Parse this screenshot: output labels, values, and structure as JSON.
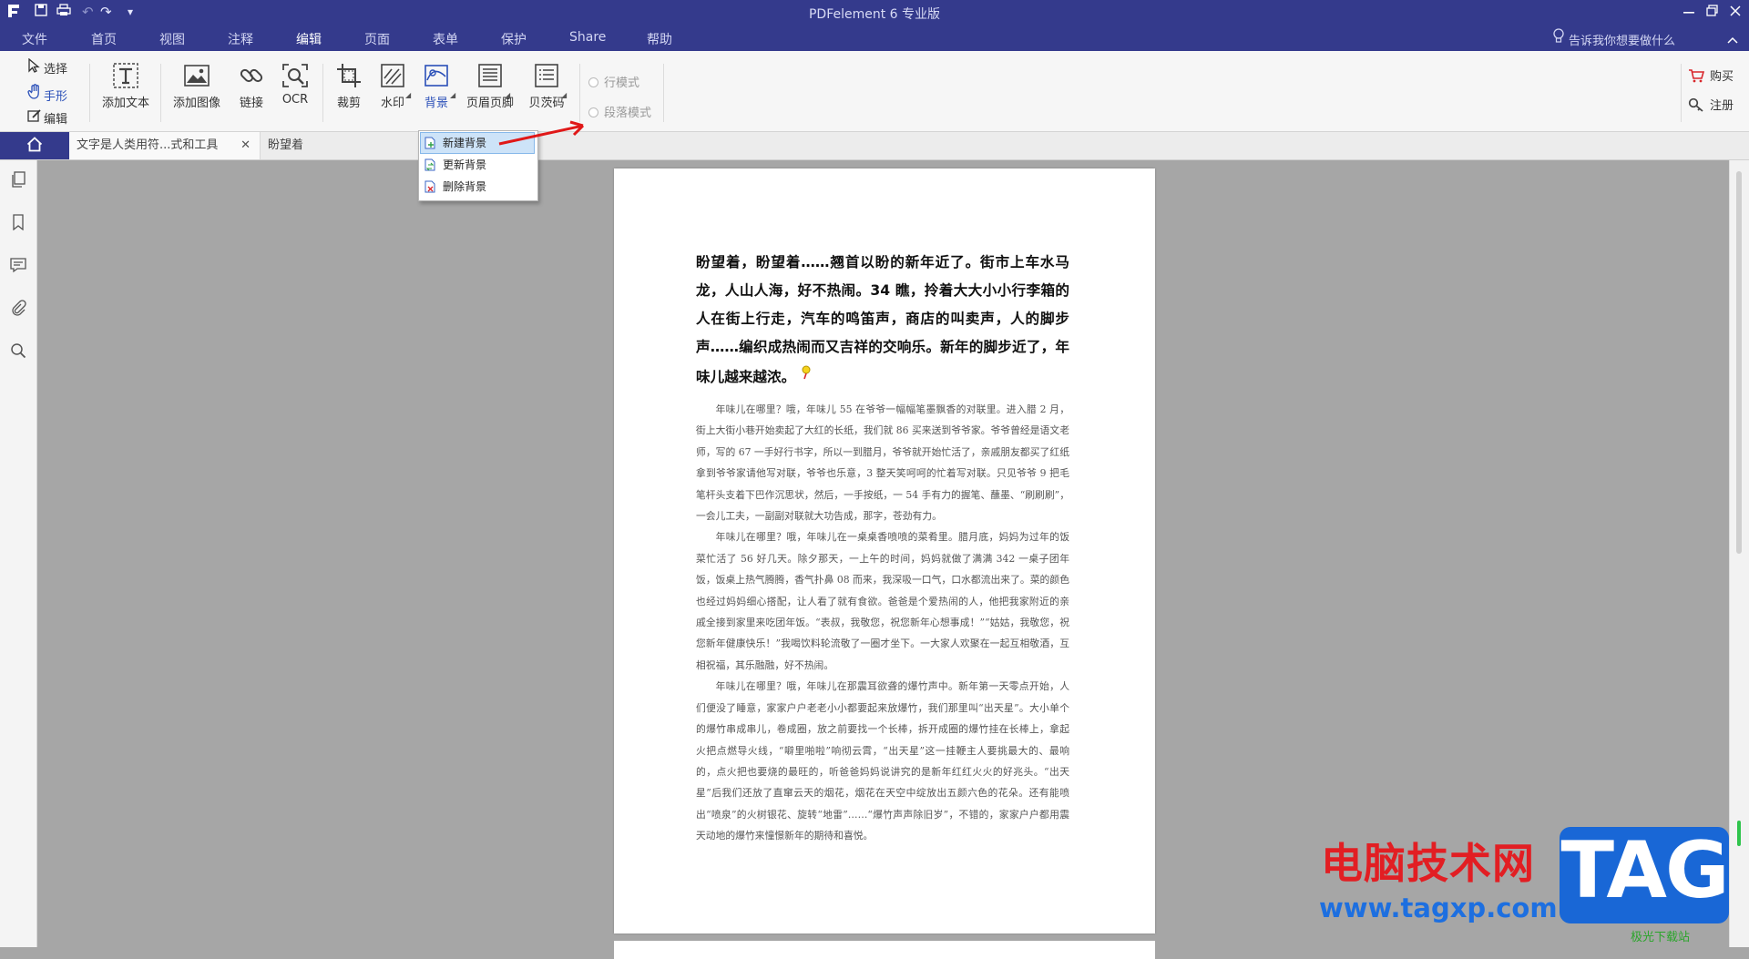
{
  "app": {
    "title": "PDFelement  6 专业版",
    "quick_access": {
      "undo": "↶",
      "redo": "↷",
      "more": "▾"
    }
  },
  "menu": {
    "items": [
      "文件",
      "首页",
      "视图",
      "注释",
      "编辑",
      "页面",
      "表单",
      "保护",
      "Share",
      "帮助"
    ],
    "active": "编辑",
    "tell_me": "告诉我你想要做什么"
  },
  "ribbon": {
    "select": "选择",
    "hand": "手形",
    "edit": "编辑",
    "add_text": "添加文本",
    "add_image": "添加图像",
    "link": "链接",
    "ocr": "OCR",
    "crop": "裁剪",
    "watermark": "水印",
    "background": "背景",
    "header_footer": "页眉页脚",
    "bates": "贝茨码",
    "line_mode": "行模式",
    "paragraph_mode": "段落模式",
    "buy": "购买",
    "register": "注册"
  },
  "tabs": [
    {
      "label": "文字是人类用符...式和工具",
      "close": "✕"
    },
    {
      "label": "盼望着"
    }
  ],
  "background_menu": {
    "items": [
      "新建背景",
      "更新背景",
      "删除背景"
    ],
    "highlighted": "新建背景"
  },
  "document": {
    "heading": "盼望着，盼望着……翘首以盼的新年近了。街市上车水马龙，人山人海，好不热闹。34 瞧，拎着大大小小行李箱的人在街上行走，汽车的鸣笛声，商店的叫卖声，人的脚步声……编织成热闹而又吉祥的交响乐。新年的脚步近了，年味儿越来越浓。",
    "p1": "年味儿在哪里？哦，年味儿 55 在爷爷一幅幅笔墨飘香的对联里。进入腊 2 月，街上大街小巷开始卖起了大红的长纸，我们就 86 买来送到爷爷家。爷爷曾经是语文老师，写的 67 一手好行书字，所以一到腊月，爷爷就开始忙活了，亲戚朋友都买了红纸拿到爷爷家请他写对联，爷爷也乐意，3 整天笑呵呵的忙着写对联。只见爷爷 9 把毛笔杆头支着下巴作沉思状，然后，一手按纸，一 54 手有力的握笔、蘸墨、“刷刷刷”，一会儿工夫，一副副对联就大功告成，那字，苍劲有力。",
    "p2": "年味儿在哪里？哦，年味儿在一桌桌香喷喷的菜肴里。腊月底，妈妈为过年的饭菜忙活了 56 好几天。除夕那天，一上午的时间，妈妈就做了满满 342 一桌子团年饭，饭桌上热气腾腾，香气扑鼻 08 而来，我深吸一口气，口水都流出来了。菜的颜色也经过妈妈细心搭配，让人看了就有食欲。爸爸是个爱热闹的人，他把我家附近的亲戚全接到家里来吃团年饭。“表叔，我敬您，祝您新年心想事成！”“姑姑，我敬您，祝您新年健康快乐！”我喝饮料轮流敬了一圈才坐下。一大家人欢聚在一起互相敬酒，互相祝福，其乐融融，好不热闹。",
    "p3": "年味儿在哪里？哦，年味儿在那震耳欲聋的爆竹声中。新年第一天零点开始，人们便没了睡意，家家户户老老小小都要起来放爆竹，我们那里叫“出天星”。大小单个的爆竹串成串儿，卷成圈，放之前要找一个长棒，拆开成圈的爆竹挂在长棒上，拿起火把点燃导火线，“噼里啪啦”响彻云霄，“出天星”这一挂鞭主人要挑最大的、最响的，点火把也要烧的最旺的，听爸爸妈妈说讲究的是新年红红火火的好兆头。“出天星”后我们还放了直窜云天的烟花，烟花在天空中绽放出五颜六色的花朵。还有能喷出“喷泉”的火树银花、旋转“地雷”……“爆竹声声除旧岁”，不错的，家家户户都用震天动地的爆竹来憧憬新年的期待和喜悦。"
  },
  "watermark": {
    "site_name": "电脑技术网",
    "url": "www.tagxp.com",
    "tag": "TAG",
    "small": "极光下载站"
  }
}
